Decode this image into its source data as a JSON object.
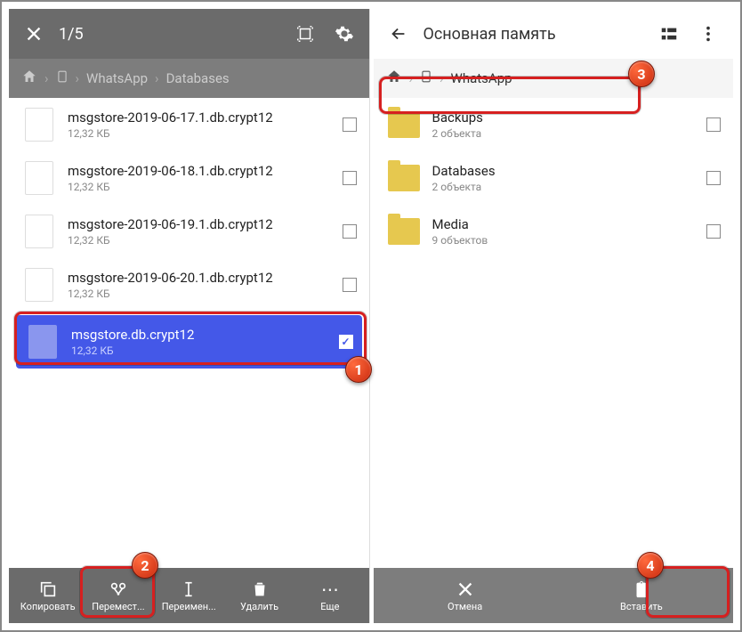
{
  "left": {
    "counter": "1/5",
    "breadcrumb": {
      "b1": "WhatsApp",
      "b2": "Databases"
    },
    "files": [
      {
        "name": "msgstore-2019-06-17.1.db.crypt12",
        "size": "12,32 КБ"
      },
      {
        "name": "msgstore-2019-06-18.1.db.crypt12",
        "size": "12,32 КБ"
      },
      {
        "name": "msgstore-2019-06-19.1.db.crypt12",
        "size": "12,32 КБ"
      },
      {
        "name": "msgstore-2019-06-20.1.db.crypt12",
        "size": "12,32 КБ"
      },
      {
        "name": "msgstore.db.crypt12",
        "size": "12,32 КБ"
      }
    ],
    "actions": {
      "copy": "Копировать",
      "move": "Перемест...",
      "rename": "Переимен...",
      "delete": "Удалить",
      "more": "Еще"
    }
  },
  "right": {
    "title": "Основная память",
    "breadcrumb": {
      "b1": "WhatsApp"
    },
    "folders": [
      {
        "name": "Backups",
        "meta": "2 объекта"
      },
      {
        "name": "Databases",
        "meta": "2 объекта"
      },
      {
        "name": "Media",
        "meta": "9 объектов"
      }
    ],
    "actions": {
      "cancel": "Отмена",
      "paste": "Вставить"
    }
  }
}
